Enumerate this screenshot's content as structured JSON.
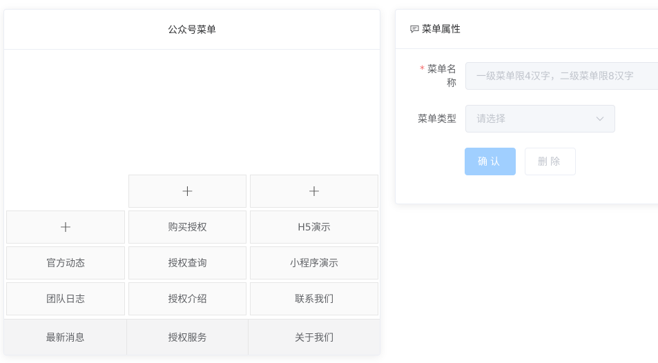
{
  "left_panel": {
    "title": "公众号菜单",
    "add_glyph": "+",
    "submenu_rows": [
      [
        "+",
        "购买授权",
        "H5演示"
      ],
      [
        "官方动态",
        "授权查询",
        "小程序演示"
      ],
      [
        "团队日志",
        "授权介绍",
        "联系我们"
      ]
    ],
    "main_menu": [
      "最新消息",
      "授权服务",
      "关于我们"
    ]
  },
  "right_panel": {
    "title": "菜单属性",
    "title_icon": "comment-icon",
    "name_label": "菜单名称",
    "required_mark": "*",
    "name_placeholder": "一级菜单限4汉字，二级菜单限8汉字",
    "type_label": "菜单类型",
    "type_placeholder": "请选择",
    "confirm_label": "确认",
    "delete_label": "删除"
  },
  "colors": {
    "primary_disabled": "#a0cfff",
    "required": "#f56c6c",
    "placeholder": "#c0c4cc"
  }
}
